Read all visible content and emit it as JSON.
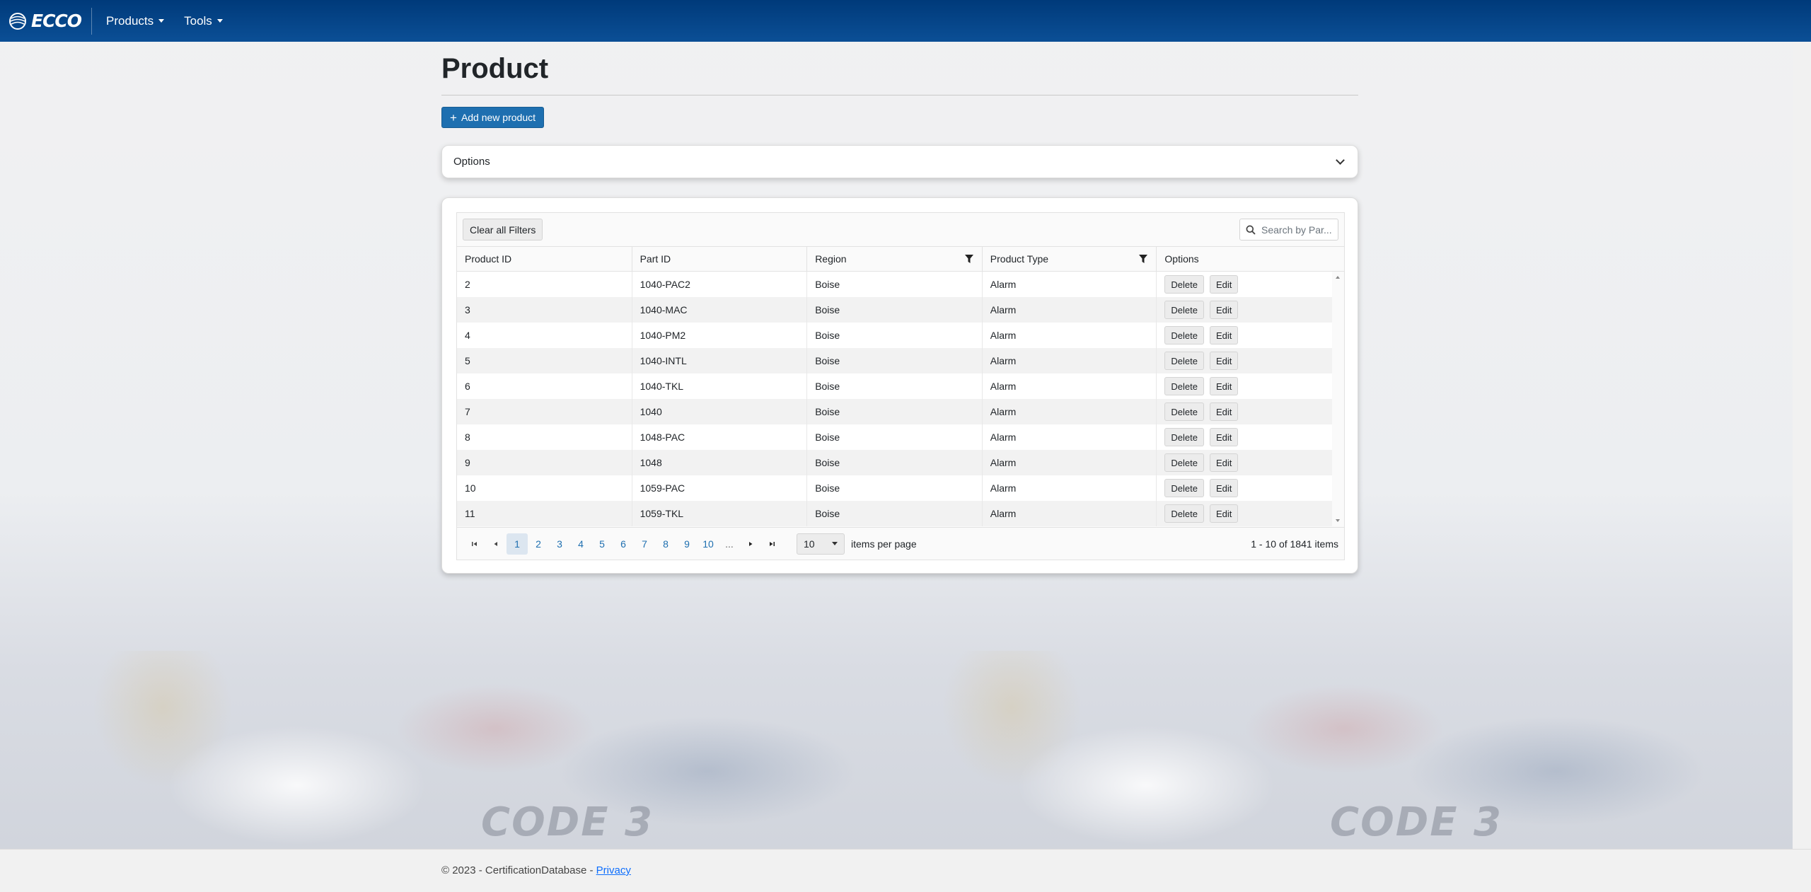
{
  "navbar": {
    "brand": "ECCO",
    "menus": [
      {
        "label": "Products"
      },
      {
        "label": "Tools"
      }
    ]
  },
  "page": {
    "title": "Product",
    "add_button": "Add new product",
    "options_label": "Options"
  },
  "grid": {
    "clear_filters": "Clear all Filters",
    "search_placeholder": "Search by Par...",
    "columns": [
      "Product ID",
      "Part ID",
      "Region",
      "Product Type",
      "Options"
    ],
    "rows": [
      {
        "product_id": "2",
        "part_id": "1040-PAC2",
        "region": "Boise",
        "type": "Alarm"
      },
      {
        "product_id": "3",
        "part_id": "1040-MAC",
        "region": "Boise",
        "type": "Alarm"
      },
      {
        "product_id": "4",
        "part_id": "1040-PM2",
        "region": "Boise",
        "type": "Alarm"
      },
      {
        "product_id": "5",
        "part_id": "1040-INTL",
        "region": "Boise",
        "type": "Alarm"
      },
      {
        "product_id": "6",
        "part_id": "1040-TKL",
        "region": "Boise",
        "type": "Alarm"
      },
      {
        "product_id": "7",
        "part_id": "1040",
        "region": "Boise",
        "type": "Alarm"
      },
      {
        "product_id": "8",
        "part_id": "1048-PAC",
        "region": "Boise",
        "type": "Alarm"
      },
      {
        "product_id": "9",
        "part_id": "1048",
        "region": "Boise",
        "type": "Alarm"
      },
      {
        "product_id": "10",
        "part_id": "1059-PAC",
        "region": "Boise",
        "type": "Alarm"
      },
      {
        "product_id": "11",
        "part_id": "1059-TKL",
        "region": "Boise",
        "type": "Alarm"
      }
    ],
    "row_actions": {
      "delete": "Delete",
      "edit": "Edit"
    },
    "pager": {
      "pages": [
        "1",
        "2",
        "3",
        "4",
        "5",
        "6",
        "7",
        "8",
        "9",
        "10"
      ],
      "active_page": "1",
      "ellipsis": "...",
      "page_size": "10",
      "items_per_page_label": "items per page",
      "info": "1 - 10 of 1841 items"
    }
  },
  "footer": {
    "copyright": "© 2023 - CertificationDatabase -",
    "privacy": "Privacy"
  },
  "background": {
    "watermark_text": "CODE 3"
  }
}
